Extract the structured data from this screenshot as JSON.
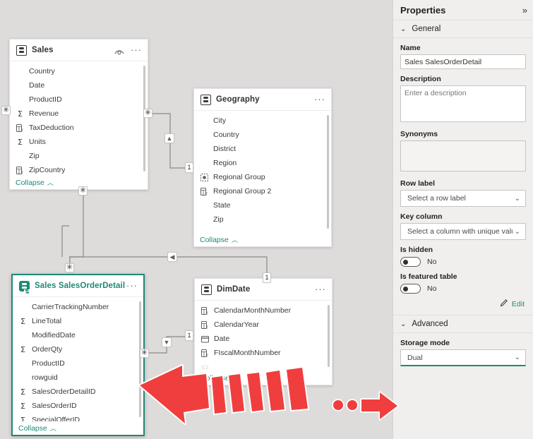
{
  "app": {
    "canvas_bg": "#dedbdb",
    "accent_green": "#1d8a76",
    "annotation_red": "#f03e3e"
  },
  "tables": [
    {
      "name": "Sales",
      "selected": false,
      "icon": "table-icon",
      "has_hidden_eye": true,
      "collapse_label": "Collapse",
      "fields": [
        {
          "name": "Country",
          "icon": "none"
        },
        {
          "name": "Date",
          "icon": "none"
        },
        {
          "name": "ProductID",
          "icon": "none"
        },
        {
          "name": "Revenue",
          "icon": "sigma"
        },
        {
          "name": "TaxDeduction",
          "icon": "calculated-column"
        },
        {
          "name": "Units",
          "icon": "sigma"
        },
        {
          "name": "Zip",
          "icon": "none"
        },
        {
          "name": "ZipCountry",
          "icon": "calculated-column"
        }
      ]
    },
    {
      "name": "Geography",
      "selected": false,
      "icon": "table-icon",
      "has_hidden_eye": false,
      "collapse_label": "Collapse",
      "fields": [
        {
          "name": "City",
          "icon": "none"
        },
        {
          "name": "Country",
          "icon": "none"
        },
        {
          "name": "District",
          "icon": "none"
        },
        {
          "name": "Region",
          "icon": "none"
        },
        {
          "name": "Regional Group",
          "icon": "group"
        },
        {
          "name": "Regional Group 2",
          "icon": "calculated-column"
        },
        {
          "name": "State",
          "icon": "none"
        },
        {
          "name": "Zip",
          "icon": "none"
        },
        {
          "name": "",
          "icon": "none",
          "partial": true
        }
      ]
    },
    {
      "name": "Sales SalesOrderDetail",
      "selected": true,
      "icon": "table-icon-dual",
      "has_hidden_eye": false,
      "collapse_label": "Collapse",
      "fields": [
        {
          "name": "CarrierTrackingNumber",
          "icon": "none"
        },
        {
          "name": "LineTotal",
          "icon": "sigma"
        },
        {
          "name": "ModifiedDate",
          "icon": "none"
        },
        {
          "name": "OrderQty",
          "icon": "sigma"
        },
        {
          "name": "ProductID",
          "icon": "none"
        },
        {
          "name": "rowguid",
          "icon": "none"
        },
        {
          "name": "SalesOrderDetailID",
          "icon": "sigma"
        },
        {
          "name": "SalesOrderID",
          "icon": "sigma"
        },
        {
          "name": "SpecialOfferID",
          "icon": "sigma"
        }
      ]
    },
    {
      "name": "DimDate",
      "selected": false,
      "icon": "table-icon",
      "has_hidden_eye": false,
      "collapse_label": "Collapse",
      "fields": [
        {
          "name": "CalendarMonthNumber",
          "icon": "calculated-column"
        },
        {
          "name": "CalendarYear",
          "icon": "calculated-column"
        },
        {
          "name": "Date",
          "icon": "date"
        },
        {
          "name": "FIscalMonthNumber",
          "icon": "calculated-column"
        },
        {
          "name": "",
          "icon": "none",
          "partial": true
        }
      ]
    }
  ],
  "relationships": [
    {
      "from": "Sales",
      "to": "Geography",
      "from_card": "*",
      "to_card": "1",
      "direction": "single"
    },
    {
      "from": "Sales",
      "to": "Sales SalesOrderDetail",
      "from_card": "*",
      "to_card": "*",
      "direction": "both"
    },
    {
      "from": "Geography",
      "to": "DimDate",
      "from_card": "*",
      "to_card": "1",
      "direction": "single"
    },
    {
      "from": "Sales SalesOrderDetail",
      "to": "DimDate",
      "from_card": "*",
      "to_card": "1",
      "direction": "single"
    }
  ],
  "properties": {
    "title": "Properties",
    "collapse_icon": "double-chevron-right-icon",
    "sections": [
      {
        "key": "general",
        "label": "General"
      },
      {
        "key": "advanced",
        "label": "Advanced"
      }
    ],
    "name": {
      "label": "Name",
      "value": "Sales SalesOrderDetail"
    },
    "description": {
      "label": "Description",
      "value": "",
      "placeholder": "Enter a description"
    },
    "synonyms": {
      "label": "Synonyms",
      "value": ""
    },
    "row_label": {
      "label": "Row label",
      "value": "Select a row label"
    },
    "key_column": {
      "label": "Key column",
      "value": "Select a column with unique values"
    },
    "is_hidden": {
      "label": "Is hidden",
      "value": "No"
    },
    "is_featured_table": {
      "label": "Is featured table",
      "value": "No"
    },
    "edit": {
      "label": "Edit",
      "icon": "pencil-icon"
    },
    "storage_mode": {
      "label": "Storage mode",
      "value": "Dual"
    }
  },
  "annotations": [
    {
      "id": "arrow-left-dashed",
      "points_to": "Sales SalesOrderDetail table",
      "color": "#f03e3e"
    },
    {
      "id": "arrow-right-dotted",
      "points_to": "Storage mode Dual",
      "color": "#f03e3e"
    }
  ]
}
